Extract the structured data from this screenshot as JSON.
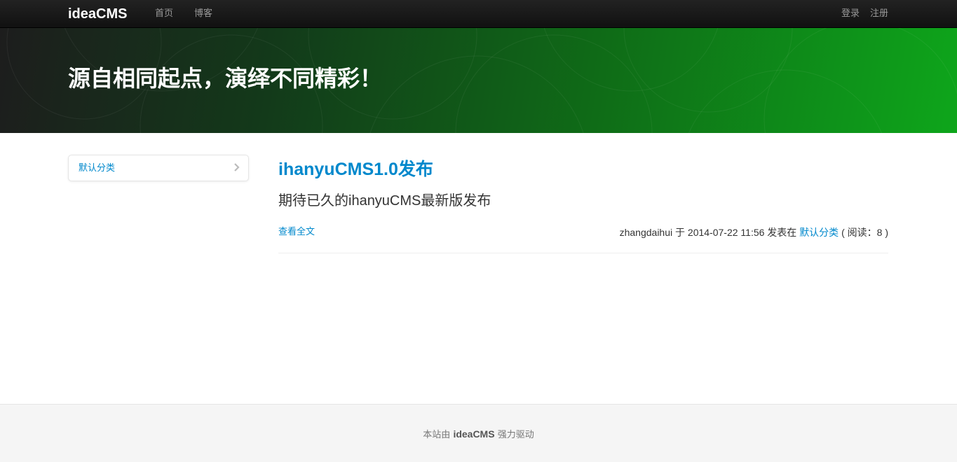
{
  "navbar": {
    "brand": "ideaCMS",
    "links": [
      {
        "label": "首页"
      },
      {
        "label": "博客"
      }
    ],
    "auth": {
      "login": "登录",
      "register": "注册"
    }
  },
  "hero": {
    "title": "源自相同起点，演绎不同精彩！"
  },
  "sidebar": {
    "categories": [
      {
        "label": "默认分类",
        "icon": "chevron-right-icon"
      }
    ]
  },
  "post": {
    "title": "ihanyuCMS1.0发布",
    "summary": "期待已久的ihanyuCMS最新版发布",
    "read_more": "查看全文",
    "author": "zhangdaihui",
    "at": "于",
    "datetime": "2014-07-22 11:56",
    "published_in": "发表在",
    "category": "默认分类",
    "reads_prefix": "( 阅读：",
    "reads": "8",
    "reads_suffix": ")"
  },
  "footer": {
    "prefix": "本站由",
    "brand": "ideaCMS",
    "suffix": "强力驱动"
  },
  "colors": {
    "link": "#0088cc",
    "navbar": "#1b1b1b",
    "hero_green": "#0ea61b",
    "footer_bg": "#f5f5f5"
  }
}
